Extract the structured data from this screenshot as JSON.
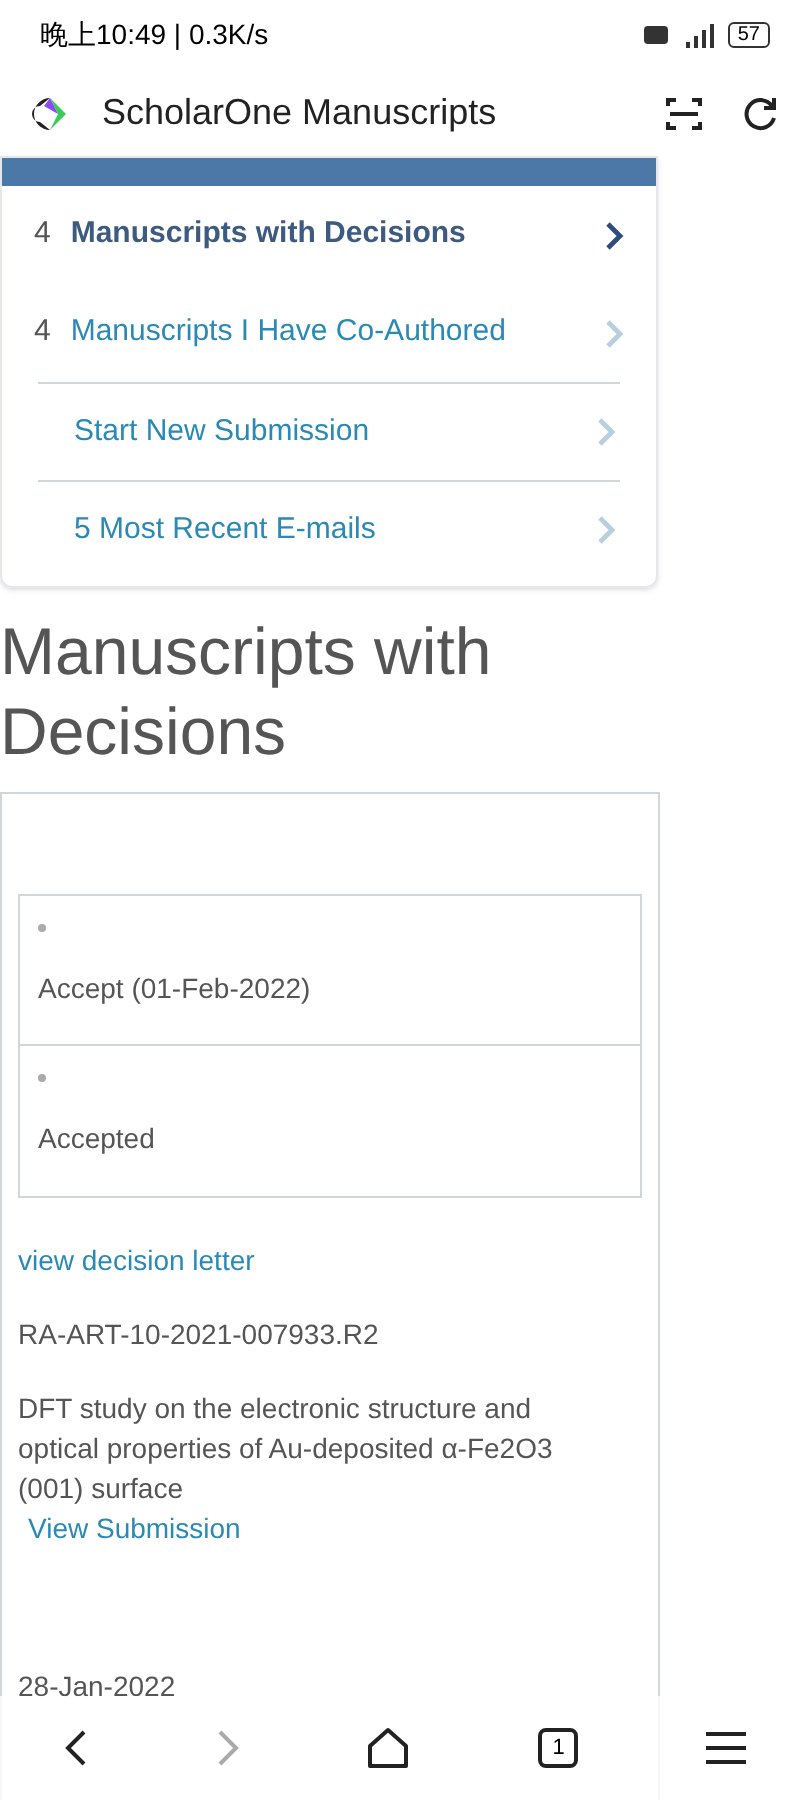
{
  "status_bar": {
    "time": "晚上10:49 | 0.3K/s",
    "battery": "57"
  },
  "browser": {
    "title": "ScholarOne Manuscripts"
  },
  "dashboard": {
    "items": [
      {
        "count": "4",
        "label": "Manuscripts with Decisions",
        "selected": true
      },
      {
        "count": "4",
        "label": "Manuscripts I Have Co-Authored",
        "selected": false
      },
      {
        "label": "Start New Submission",
        "selected": false
      },
      {
        "label": "5 Most Recent E-mails",
        "selected": false
      }
    ]
  },
  "heading": "Manuscripts with Decisions",
  "manuscript": {
    "decisions": [
      "Accept (01-Feb-2022)",
      "Accepted"
    ],
    "decision_link": "view decision letter",
    "id": "RA-ART-10-2021-007933.R2",
    "title": "DFT study on the electronic structure and optical properties of Au-deposited α-Fe2O3 (001) surface",
    "view_link": "View Submission",
    "submitted": "28-Jan-2022"
  },
  "nav_bar": {
    "tab_count": "1"
  }
}
